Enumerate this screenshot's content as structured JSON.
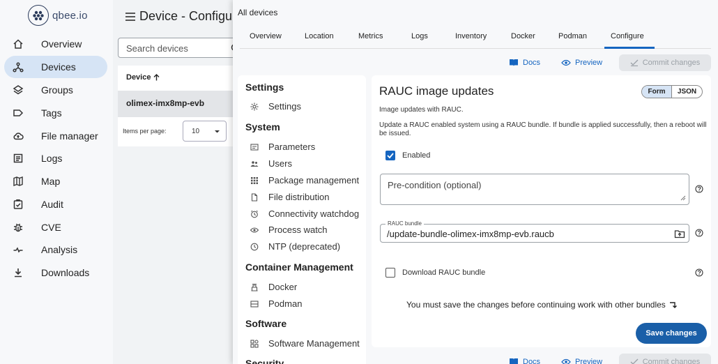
{
  "brand": {
    "name": "qbee.io"
  },
  "nav": {
    "items": [
      {
        "label": "Overview",
        "icon": "home-icon"
      },
      {
        "label": "Devices",
        "icon": "devices-icon",
        "active": true
      },
      {
        "label": "Groups",
        "icon": "layers-icon"
      },
      {
        "label": "Tags",
        "icon": "tag-icon"
      },
      {
        "label": "File manager",
        "icon": "cloud-upload-icon"
      },
      {
        "label": "Logs",
        "icon": "logs-icon"
      },
      {
        "label": "Map",
        "icon": "map-icon"
      },
      {
        "label": "Audit",
        "icon": "clipboard-check-icon"
      },
      {
        "label": "CVE",
        "icon": "bug-icon"
      },
      {
        "label": "Analysis",
        "icon": "analysis-icon"
      },
      {
        "label": "Downloads",
        "icon": "download-icon"
      }
    ]
  },
  "header": {
    "title": "Device - Configure"
  },
  "search": {
    "placeholder": "Search devices"
  },
  "device_table": {
    "column": "Device",
    "rows": [
      "olimex-imx8mp-evb"
    ],
    "items_per_page_label": "Items per page:",
    "items_per_page": "10"
  },
  "panel": {
    "breadcrumb": "All devices",
    "tabs": [
      "Overview",
      "Location",
      "Metrics",
      "Logs",
      "Inventory",
      "Docker",
      "Podman",
      "Configure"
    ],
    "active_tab": "Configure",
    "actions": {
      "docs": "Docs",
      "preview": "Preview",
      "commit": "Commit changes"
    }
  },
  "settings_menu": {
    "sections": [
      {
        "title": "Settings",
        "items": [
          {
            "label": "Settings",
            "icon": "gear-icon"
          }
        ]
      },
      {
        "title": "System",
        "items": [
          {
            "label": "Parameters",
            "icon": "parameters-icon"
          },
          {
            "label": "Users",
            "icon": "users-icon"
          },
          {
            "label": "Package management",
            "icon": "grid-icon"
          },
          {
            "label": "File distribution",
            "icon": "file-icon"
          },
          {
            "label": "Connectivity watchdog",
            "icon": "watchdog-icon"
          },
          {
            "label": "Process watch",
            "icon": "eye-icon"
          },
          {
            "label": "NTP (deprecated)",
            "icon": "clock-icon"
          }
        ]
      },
      {
        "title": "Container Management",
        "items": [
          {
            "label": "Docker",
            "icon": "docker-icon"
          },
          {
            "label": "Podman",
            "icon": "podman-icon"
          }
        ]
      },
      {
        "title": "Software",
        "items": [
          {
            "label": "Software Management",
            "icon": "apps-icon"
          }
        ]
      },
      {
        "title": "Security",
        "items": []
      }
    ]
  },
  "form": {
    "title": "RAUC image updates",
    "mode_options": [
      "Form",
      "JSON"
    ],
    "mode_selected": "Form",
    "subtitle": "Image updates with RAUC.",
    "description": "Update a RAUC enabled system using a RAUC bundle. If bundle is applied successfully, then a reboot will be issued.",
    "enabled_label": "Enabled",
    "enabled": true,
    "precondition_placeholder": "Pre-condition (optional)",
    "bundle_label": "RAUC bundle",
    "bundle_value": "/update-bundle-olimex-imx8mp-evb.raucb",
    "download_label": "Download RAUC bundle",
    "download": false,
    "save_note": "You must save the changes before continuing work with other bundles",
    "save_button": "Save changes"
  },
  "colors": {
    "accent": "#1565c0",
    "primary_button": "#1a5fa8",
    "nav_active": "#d6e4f5"
  }
}
